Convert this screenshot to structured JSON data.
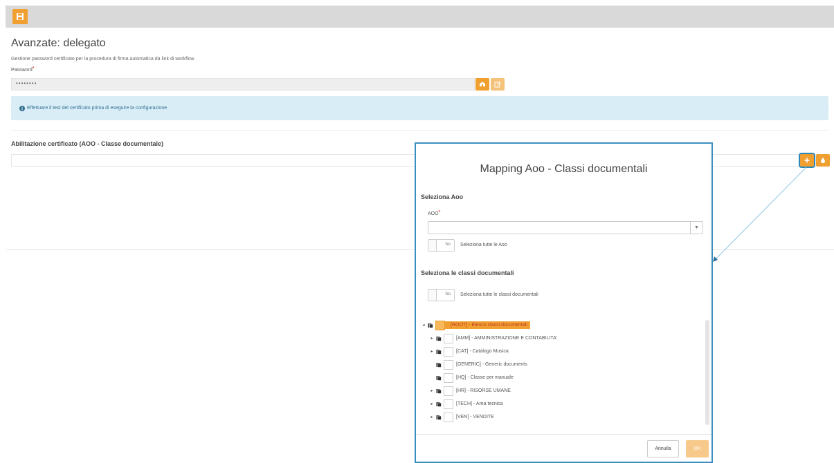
{
  "toolbar": {
    "save_icon": "save-icon"
  },
  "page": {
    "title": "Avanzate: delegato",
    "description": "Gestione password certificato per la procedura di firma automatica da link di workflow",
    "password_label": "Password",
    "required_mark": "*",
    "password_value": "••••••••",
    "info_text": "Effettuare il test del certificato prima di eseguire la configurazione",
    "cert_section_title": "Abilitazione certificato (AOO - Classe documentale)"
  },
  "modal": {
    "title": "Mapping Aoo - Classi documentali",
    "aoo_section_title": "Seleziona Aoo",
    "aoo_label": "AOO",
    "required_mark": "*",
    "aoo_selected": "",
    "toggle_no": "No",
    "select_all_aoo_label": "Seleziona tutte le Aoo",
    "classes_section_title": "Seleziona le classi documentali",
    "select_all_classes_label": "Seleziona tutte le classi documentali",
    "tree": [
      {
        "label": "[ROOT] - Elenco classi documentali",
        "expandable": true,
        "root": true
      },
      {
        "label": "[AMM] - AMMINISTRAZIONE E CONTABILITA'",
        "expandable": true
      },
      {
        "label": "[CAT] - Catalogo Musica",
        "expandable": true
      },
      {
        "label": "[GENERIC] - Generic documents",
        "expandable": false
      },
      {
        "label": "[HQ] - Classe per manuale",
        "expandable": false
      },
      {
        "label": "[HR] - RISORSE UMANE",
        "expandable": true
      },
      {
        "label": "[TECH] - Area tecnica",
        "expandable": true
      },
      {
        "label": "[VEN] - VENDITE",
        "expandable": true
      }
    ],
    "cancel_label": "Annulla",
    "ok_label": "OK"
  },
  "colors": {
    "accent": "#f0a030",
    "info_bg": "#d9edf7",
    "info_text": "#31708f",
    "modal_border": "#3a8fc1",
    "required": "#d9534f"
  }
}
